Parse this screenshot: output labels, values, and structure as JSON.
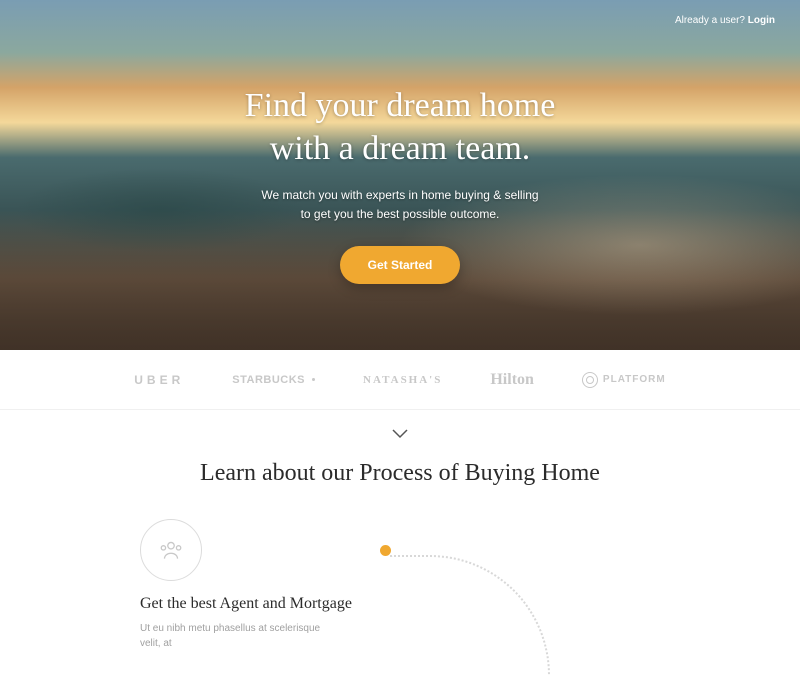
{
  "topbar": {
    "prompt": "Already a user?",
    "login": "Login"
  },
  "hero": {
    "title_line1": "Find your dream home",
    "title_line2": "with a dream team.",
    "sub_line1": "We match you with experts in home buying & selling",
    "sub_line2": "to get you the best possible outcome.",
    "cta": "Get Started"
  },
  "logos": [
    "UBER",
    "STARBUCKS",
    "NATASHA'S",
    "Hilton",
    "PLATFORM"
  ],
  "section": {
    "title": "Learn about our Process of Buying Home"
  },
  "process": {
    "step1": {
      "title": "Get the best Agent and Mortgage",
      "text": "Ut eu nibh metu phasellus at scelerisque velit, at"
    }
  }
}
